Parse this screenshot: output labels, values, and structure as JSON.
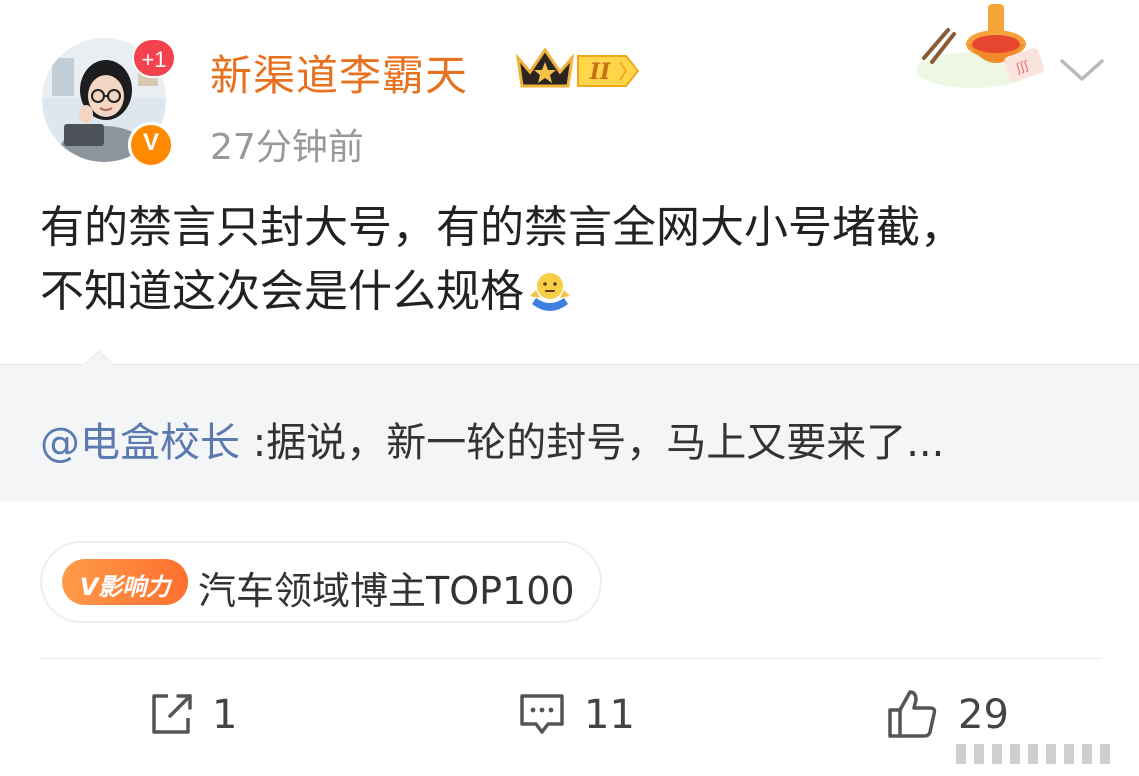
{
  "post": {
    "author": {
      "name": "新渠道李霸天",
      "notification_badge": "+1",
      "verified_mark": "V",
      "level_badge": "II"
    },
    "timestamp": "27分钟前",
    "text_line1": "有的禁言只封大号，有的禁言全网大小号堵截，",
    "text_line2": "不知道这次会是什么规格",
    "emoji": "shrug-emoji",
    "quote": {
      "mention": "@电盒校长",
      "text": " :据说，新一轮的封号，马上又要来了..."
    },
    "tag": {
      "pill_label": "V影响力",
      "text": "汽车领域博主TOP100"
    }
  },
  "actions": {
    "share_count": "1",
    "comment_count": "11",
    "like_count": "29"
  },
  "colors": {
    "username": "#e8711f",
    "mention": "#5b7ab0",
    "badge_red": "#f3414d",
    "verified_orange": "#ff8a00",
    "quote_bg": "#f4f5f7"
  }
}
